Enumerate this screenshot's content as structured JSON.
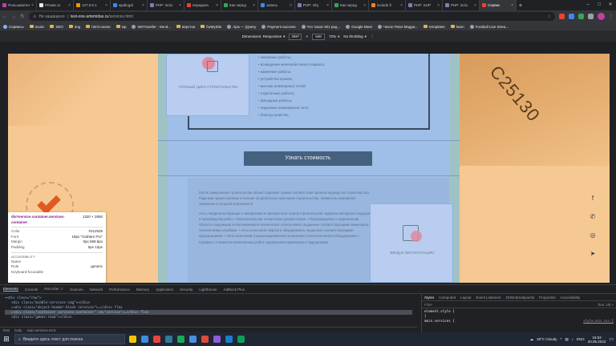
{
  "browser": {
    "tabs": [
      {
        "title": "Пользовател",
        "color": "#c63ea5"
      },
      {
        "title": "Private ai",
        "color": "#e8eaed"
      },
      {
        "title": "127.0.0.1",
        "color": "#f29900"
      },
      {
        "title": "wpdtcgdr",
        "color": "#4285f4"
      },
      {
        "title": "PHP: inclu",
        "color": "#7b7fb5"
      },
      {
        "title": "передача",
        "color": "#e94235"
      },
      {
        "title": "Как перед",
        "color": "#34a853"
      },
      {
        "title": "запись",
        "color": "#4285f4"
      },
      {
        "title": "PHP: Obj",
        "color": "#7b7fb5"
      },
      {
        "title": "Как перед",
        "color": "#34a853"
      },
      {
        "title": "include fi",
        "color": "#f48024"
      },
      {
        "title": "PHP: SUP",
        "color": "#7b7fb5"
      },
      {
        "title": "PHP: inclu",
        "color": "#7b7fb5"
      },
      {
        "title": "Сервис",
        "color": "#e94235",
        "active": true
      }
    ],
    "new_tab": "+",
    "address": {
      "warning": "Не защищено",
      "host": "test-one.artemidas.ru",
      "path": "/services.html"
    },
    "bookmarks": [
      {
        "label": "Сервисы",
        "type": "app"
      },
      {
        "label": "music",
        "type": "folder"
      },
      {
        "label": "SEO",
        "type": "folder"
      },
      {
        "label": "img",
        "type": "folder"
      },
      {
        "label": "html-course",
        "type": "folder"
      },
      {
        "label": "wp",
        "type": "folder"
      },
      {
        "label": "WeTransfer - Send...",
        "type": "site"
      },
      {
        "label": "верстка",
        "type": "folder"
      },
      {
        "label": "forMySite",
        "type": "folder"
      },
      {
        "label": "Ajax — jQuery",
        "type": "site"
      },
      {
        "label": "Payment success",
        "type": "site"
      },
      {
        "label": "Что такое 301 ред...",
        "type": "site"
      },
      {
        "label": "Google Meet",
        "type": "site"
      },
      {
        "label": "Чехол Реал Мадри...",
        "type": "site"
      },
      {
        "label": "templates",
        "type": "folder"
      },
      {
        "label": "learn",
        "type": "folder"
      },
      {
        "label": "Football Live Strea...",
        "type": "site"
      }
    ]
  },
  "device_toolbar": {
    "device": "Dimensions: Responsive",
    "width": "2597",
    "sep": "×",
    "height": "848",
    "zoom": "72%",
    "throttle": "No throttling"
  },
  "site": {
    "card1_caption": "ПОЛНЫЙ ЦИКЛ СТРОИТЕЛЬСТВА",
    "services": [
      "• земляные работы;",
      "• возведение железобетонного каркаса;",
      "• каменные работы;",
      "• устройство кровли;",
      "• монтаж инженерных сетей;",
      "• отделочные работы;",
      "• фасадные работы;",
      "• наружные инженерные сети;",
      "• благоустройство."
    ],
    "cta": "Узнать стоимость",
    "paragraphs": [
      "После завершения строительства объект подлежит оценке соответствия органом надзора на строительство. Ради вам предоставляем в течение 10 дней после окончания строительства. Заявитель направляет заявление в который прилагаются:",
      "Акты, свидетельствующие о завершении и приемке всех этапов строительства: журналы авторского надзора и производства работ. • Исполнительная техническая документация. • Подтверждение о подключении объекта к наружным сетям инженерно-технического обеспечения, выданные соответствующими инженерно-техническими службами. • Акты испытаний лифтов и оборудования, выданные соответствующими организациями. • Акты испытаний специализированного инженерно-технологического оборудования. • Справка о стоимости выполненных работ подписанная заказчиком и подрядчиком."
    ],
    "card2_caption": "ВВОД В ЭКСПЛУАТАЦИЮ",
    "stamp": "C25130",
    "social": [
      "f",
      "✆",
      "◎",
      "➤"
    ]
  },
  "inspect_tooltip": {
    "selector": "div#service.container.services-container",
    "size": "1320 × 2650",
    "rows": [
      {
        "k": "Color",
        "v": "#212529"
      },
      {
        "k": "Font",
        "v": "18px \"Gotham Pro\""
      },
      {
        "k": "Margin",
        "v": "0px 658.5px"
      },
      {
        "k": "Padding",
        "v": "0px 12px"
      }
    ],
    "section": "ACCESSIBILITY",
    "a11y": [
      {
        "k": "Name",
        "v": ""
      },
      {
        "k": "Role",
        "v": "generic"
      },
      {
        "k": "Keyboard-focusable",
        "v": ""
      }
    ]
  },
  "devtools": {
    "tabs": [
      "Elements",
      "Console",
      "Recorder ⚠",
      "Sources",
      "Network",
      "Performance",
      "Memory",
      "Application",
      "Security",
      "Lighthouse",
      "AdBlock Plus"
    ],
    "lines": [
      {
        "indent": 0,
        "text": "▾<div class=\"row\">"
      },
      {
        "indent": 1,
        "text": "<div class=\"middle-services-img\"></div>"
      },
      {
        "indent": 1,
        "text": "▸<div class=\"object-header-block services\">…</div> flex"
      },
      {
        "indent": 1,
        "text": "▸<div class=\"container services-container\" id=\"service\">…</div> flex",
        "selected": true
      },
      {
        "indent": 1,
        "text": "<div class=\"gabes-road\"></div>"
      }
    ],
    "crumbs": [
      "html",
      "body",
      "main.services.mt-5"
    ],
    "styles_tabs": [
      "Styles",
      "Computed",
      "Layout",
      "Event Listeners",
      "DOM Breakpoints",
      "Properties",
      "Accessibility"
    ],
    "filter_placeholder": "Filter",
    "filter_tools": ":hov .cls +",
    "rule1": "element.style {",
    "rule1_end": "}",
    "rule2": "main.services {",
    "rule2_src": "style.min.css:1"
  },
  "taskbar": {
    "search_placeholder": "Введите здесь текст для поиска",
    "weather": "28°C Cloudy",
    "lang": "ENG",
    "time": "16:53",
    "date": "20.05.2022",
    "apps": [
      "#f5c400",
      "#3c8dde",
      "#e8433e",
      "#2d7d9a",
      "#1aaa5b",
      "#4a8fe2",
      "#d94b3a",
      "#8e5cd9",
      "#1a7ecf",
      "#0f9d58"
    ]
  }
}
